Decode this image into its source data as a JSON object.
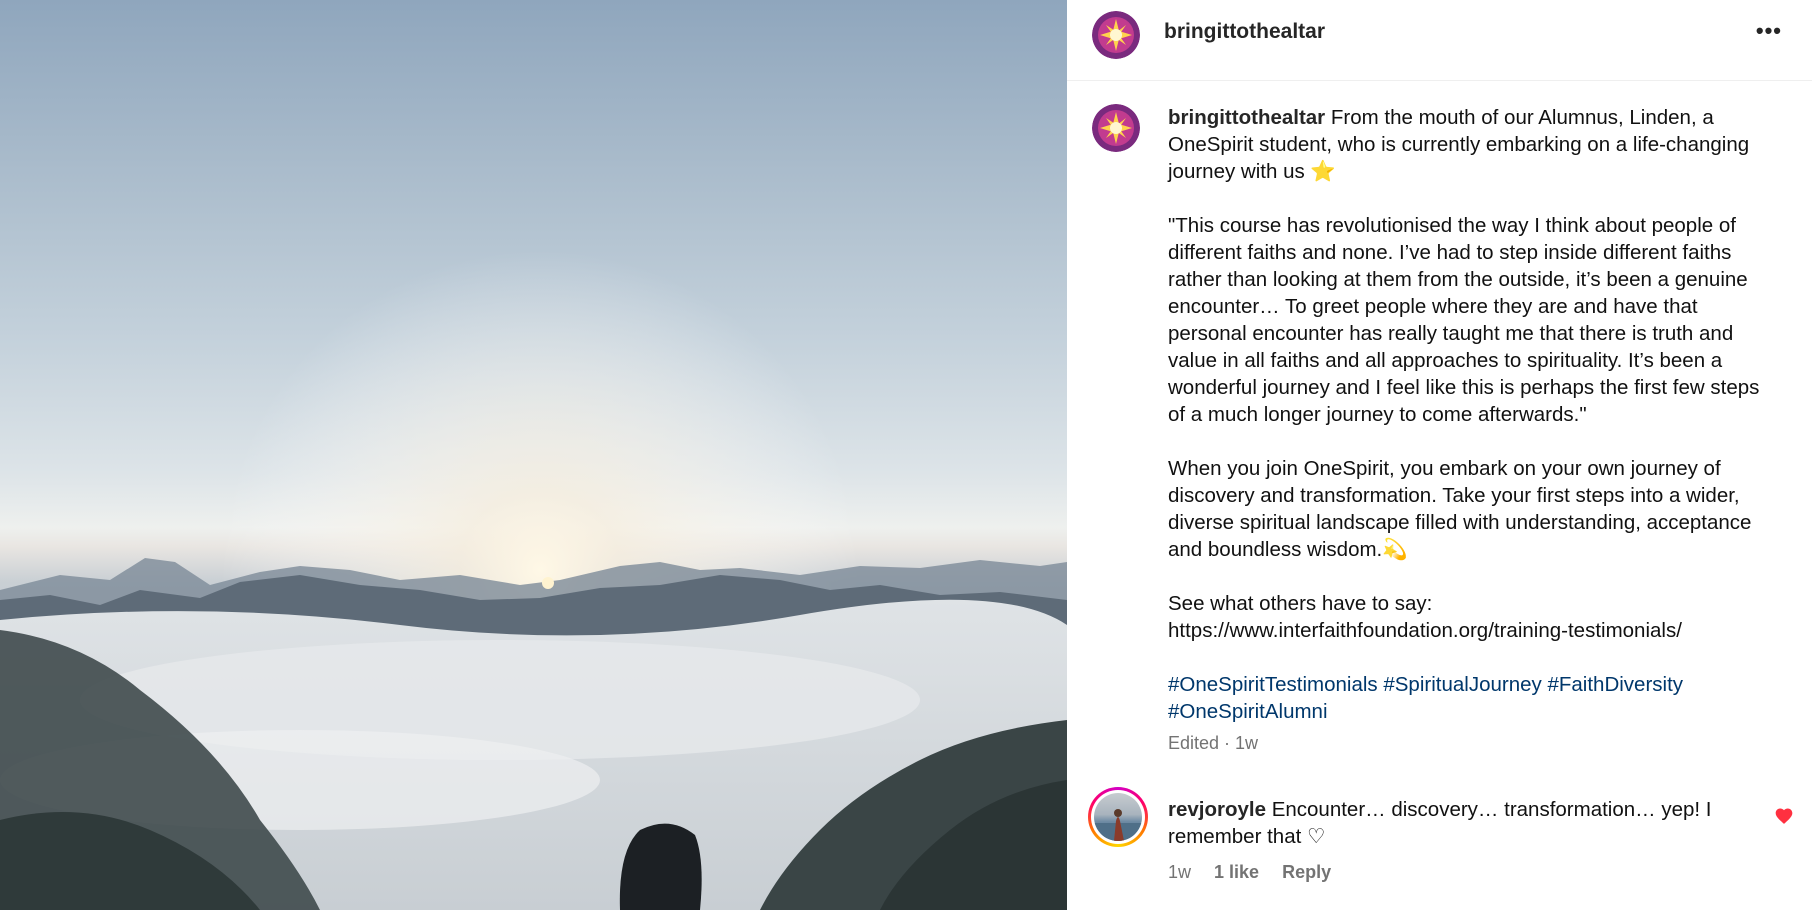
{
  "post": {
    "username": "bringittothealtar",
    "more_label": "•••",
    "caption": {
      "intro": "From the mouth of our Alumnus, Linden, a OneSpirit student, who is currently embarking on a life-changing journey with us ⭐",
      "quote": "\"This course has revolutionised the way I think about people of different faiths and none. I’ve had to step inside different faiths rather than looking at them from the outside, it’s been a genuine encounter… To greet people where they are and have that personal encounter has really taught me that there is truth and value in all faiths and all approaches to spirituality. It’s been a wonderful journey and I feel like this is perhaps the first few steps of a much longer journey to come afterwards.\"",
      "paragraph2": "When you join OneSpirit, you embark on your own journey of discovery and transformation. Take your first steps into a wider, diverse spiritual landscape filled with understanding, acceptance and boundless wisdom.💫",
      "see_others": "See what others have to say:",
      "link": "https://www.interfaithfoundation.org/training-testimonials/",
      "hashtags": [
        "#OneSpiritTestimonials",
        "#SpiritualJourney",
        "#FaithDiversity",
        "#OneSpiritAlumni"
      ]
    },
    "edited_meta": "Edited · 1w"
  },
  "comment": {
    "username": "revjoroyle",
    "text": "Encounter… discovery… transformation… yep! I remember that ♡",
    "time": "1w",
    "likes": "1 like",
    "reply_label": "Reply",
    "liked": true,
    "heart_color": "#ff3040"
  },
  "icons": {
    "more": "more-options-icon",
    "heart": "heart-icon"
  }
}
